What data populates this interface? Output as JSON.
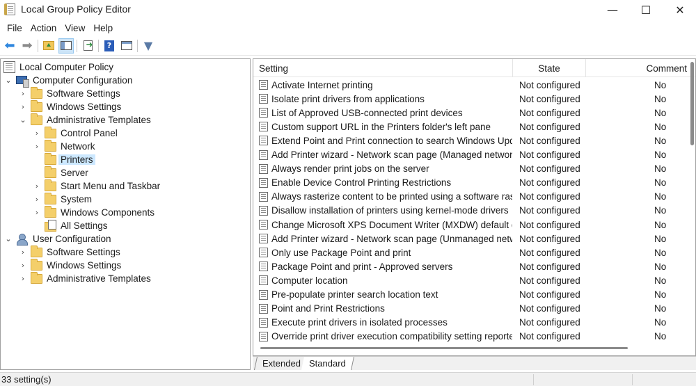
{
  "window": {
    "title": "Local Group Policy Editor",
    "minimize_glyph": "—",
    "maximize_glyph": "☐",
    "close_glyph": "✕"
  },
  "menu": [
    "File",
    "Action",
    "View",
    "Help"
  ],
  "toolbar": {
    "back_glyph": "⬅",
    "forward_glyph": "➡",
    "help_glyph": "?",
    "filter_glyph": "▼"
  },
  "tree": {
    "root": "Local Computer Policy",
    "computer_configuration": "Computer Configuration",
    "cc_software_settings": "Software Settings",
    "cc_windows_settings": "Windows Settings",
    "cc_administrative_templates": "Administrative Templates",
    "control_panel": "Control Panel",
    "network": "Network",
    "printers": "Printers",
    "server": "Server",
    "start_menu": "Start Menu and Taskbar",
    "system": "System",
    "windows_components": "Windows Components",
    "all_settings": "All Settings",
    "user_configuration": "User Configuration",
    "uc_software_settings": "Software Settings",
    "uc_windows_settings": "Windows Settings",
    "uc_administrative_templates": "Administrative Templates",
    "chev_expanded": "⌄",
    "chev_collapsed": "›"
  },
  "list": {
    "columns": {
      "setting": "Setting",
      "state": "State",
      "comment": "Comment"
    },
    "rows": [
      {
        "setting": "Activate Internet printing",
        "state": "Not configured",
        "comment": "No"
      },
      {
        "setting": "Isolate print drivers from applications",
        "state": "Not configured",
        "comment": "No"
      },
      {
        "setting": "List of Approved USB-connected print devices",
        "state": "Not configured",
        "comment": "No"
      },
      {
        "setting": "Custom support URL in the Printers folder's left pane",
        "state": "Not configured",
        "comment": "No"
      },
      {
        "setting": "Extend Point and Print connection to search Windows Update",
        "state": "Not configured",
        "comment": "No"
      },
      {
        "setting": "Add Printer wizard - Network scan page (Managed network)",
        "state": "Not configured",
        "comment": "No"
      },
      {
        "setting": "Always render print jobs on the server",
        "state": "Not configured",
        "comment": "No"
      },
      {
        "setting": "Enable Device Control Printing Restrictions",
        "state": "Not configured",
        "comment": "No"
      },
      {
        "setting": "Always rasterize content to be printed using a software raste...",
        "state": "Not configured",
        "comment": "No"
      },
      {
        "setting": "Disallow installation of printers using kernel-mode drivers",
        "state": "Not configured",
        "comment": "No"
      },
      {
        "setting": "Change Microsoft XPS Document Writer (MXDW) default ou...",
        "state": "Not configured",
        "comment": "No"
      },
      {
        "setting": "Add Printer wizard - Network scan page (Unmanaged netwo...",
        "state": "Not configured",
        "comment": "No"
      },
      {
        "setting": "Only use Package Point and print",
        "state": "Not configured",
        "comment": "No"
      },
      {
        "setting": "Package Point and print - Approved servers",
        "state": "Not configured",
        "comment": "No"
      },
      {
        "setting": "Computer location",
        "state": "Not configured",
        "comment": "No"
      },
      {
        "setting": "Pre-populate printer search location text",
        "state": "Not configured",
        "comment": "No"
      },
      {
        "setting": "Point and Print Restrictions",
        "state": "Not configured",
        "comment": "No"
      },
      {
        "setting": "Execute print drivers in isolated processes",
        "state": "Not configured",
        "comment": "No"
      },
      {
        "setting": "Override print driver execution compatibility setting reporte...",
        "state": "Not configured",
        "comment": "No"
      }
    ]
  },
  "tabs": {
    "extended": "Extended",
    "standard": "Standard"
  },
  "status": {
    "text": "33 setting(s)"
  },
  "colors": {
    "selection": "#cce8ff",
    "accent": "#2e86de",
    "folder": "#f4cf6a"
  }
}
